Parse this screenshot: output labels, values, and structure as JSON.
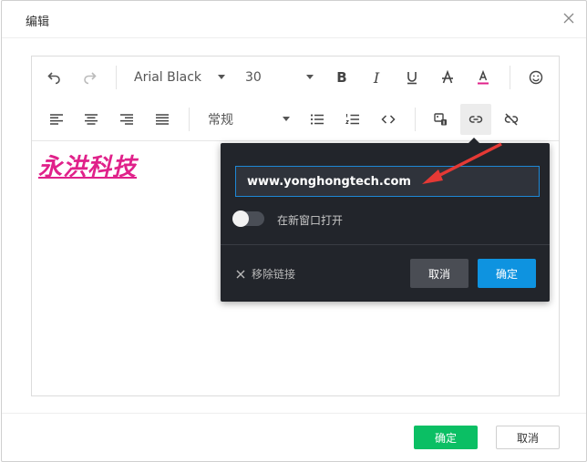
{
  "dialog": {
    "title": "编辑"
  },
  "toolbar": {
    "font_family": "Arial Black",
    "font_size": "30",
    "paragraph_style": "常规",
    "icons": [
      "undo-icon",
      "redo-icon",
      "bold-icon",
      "italic-icon",
      "underline-icon",
      "strikethrough-icon",
      "font-color-icon",
      "emoji-icon",
      "align-left-icon",
      "align-center-icon",
      "align-right-icon",
      "align-justify-icon",
      "bullet-list-icon",
      "numbered-list-icon",
      "code-icon",
      "image-icon",
      "link-icon",
      "unlink-icon"
    ]
  },
  "content": {
    "link_text": "永洪科技",
    "link_color": "#e0218a"
  },
  "link_popover": {
    "url": "www.yonghongtech.com",
    "open_new_window_label": "在新窗口打开",
    "remove_link_label": "移除链接",
    "cancel_label": "取消",
    "confirm_label": "确定",
    "confirm_color": "#0e93e0"
  },
  "footer": {
    "confirm_label": "确定",
    "cancel_label": "取消",
    "confirm_color": "#0bbf64"
  }
}
